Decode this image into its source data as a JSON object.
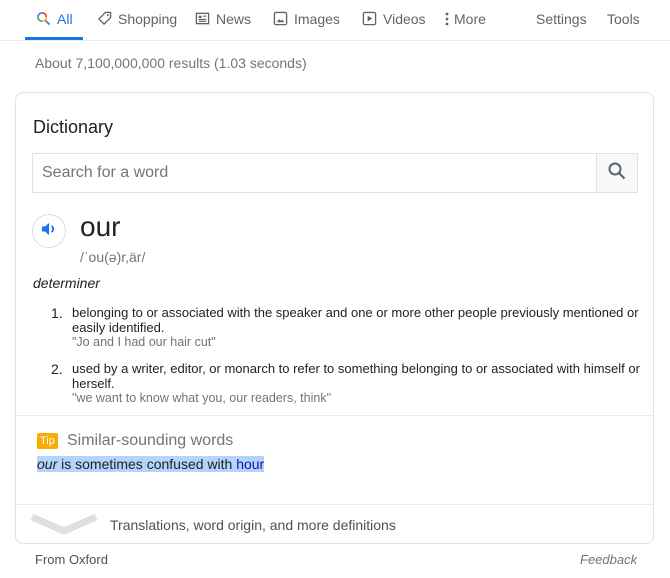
{
  "tabs": [
    {
      "label": "All",
      "icon": "search-icon",
      "active": true
    },
    {
      "label": "Shopping",
      "icon": "tag-icon"
    },
    {
      "label": "News",
      "icon": "newspaper-icon"
    },
    {
      "label": "Images",
      "icon": "image-icon"
    },
    {
      "label": "Videos",
      "icon": "play-icon"
    },
    {
      "label": "More",
      "icon": "more-vert-icon"
    },
    {
      "label": "Settings"
    },
    {
      "label": "Tools"
    }
  ],
  "result_stats": "About 7,100,000,000 results (1.03 seconds)",
  "dictionary": {
    "title": "Dictionary",
    "search_placeholder": "Search for a word",
    "search_value": "",
    "word": "our",
    "phonetic": "/ˈou(ə)r,är/",
    "part_of_speech": "determiner",
    "definitions": [
      {
        "num": "1.",
        "text": "belonging to or associated with the speaker and one or more other people previously mentioned or easily identified.",
        "example": "\"Jo and I had our hair cut\""
      },
      {
        "num": "2.",
        "text": "used by a writer, editor, or monarch to refer to something belonging to or associated with himself or herself.",
        "example": "\"we want to know what you, our readers, think\""
      }
    ],
    "tip": {
      "badge": "Tip",
      "title": "Similar-sounding words",
      "word": "our",
      "middle": " is sometimes confused with ",
      "link": "hour"
    },
    "expand_label": "Translations, word origin, and more definitions"
  },
  "footer": {
    "source": "From Oxford",
    "feedback": "Feedback"
  },
  "colors": {
    "accent": "#1a73e8",
    "tip_badge": "#f9ab00",
    "link": "#1a0dab",
    "highlight": "#b3d4fc"
  }
}
